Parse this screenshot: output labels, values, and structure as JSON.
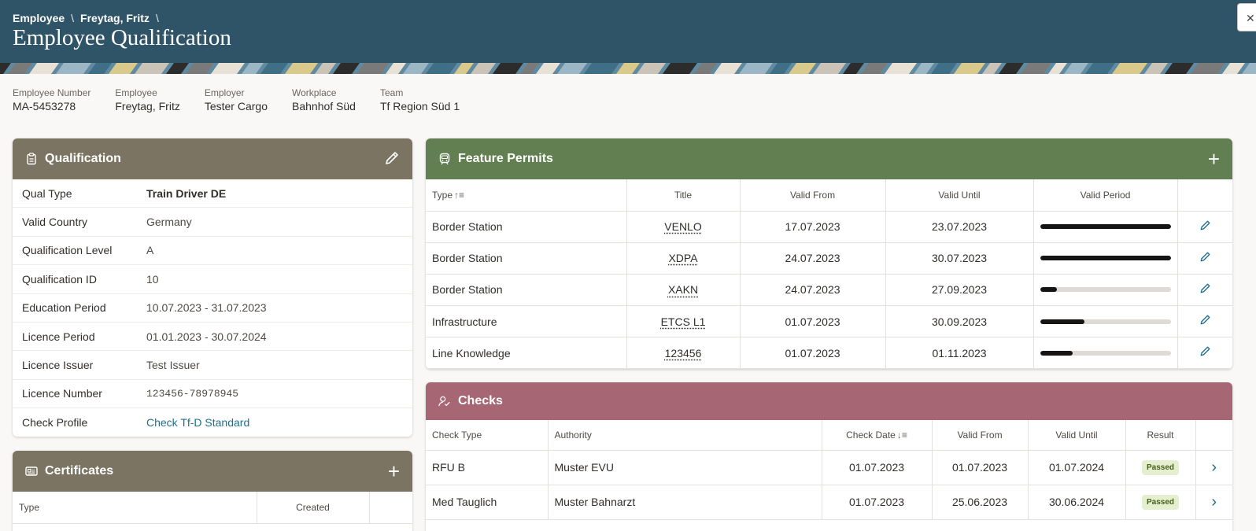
{
  "breadcrumb": {
    "items": [
      "Employee",
      "Freytag, Fritz"
    ],
    "sep": "\\"
  },
  "page_title": "Employee Qualification",
  "close_icon": "close-icon",
  "info": [
    {
      "label": "Employee Number",
      "value": "MA-5453278"
    },
    {
      "label": "Employee",
      "value": "Freytag, Fritz"
    },
    {
      "label": "Employer",
      "value": "Tester Cargo"
    },
    {
      "label": "Workplace",
      "value": "Bahnhof Süd"
    },
    {
      "label": "Team",
      "value": "Tf Region Süd 1"
    }
  ],
  "qualification": {
    "title": "Qualification",
    "icon": "clipboard-icon",
    "edit_icon": "pencil-icon",
    "color": "#7b7462",
    "rows": [
      {
        "k": "Qual Type",
        "v": "Train Driver DE"
      },
      {
        "k": "Valid Country",
        "v": "Germany"
      },
      {
        "k": "Qualification Level",
        "v": "A"
      },
      {
        "k": "Qualification ID",
        "v": "10"
      },
      {
        "k": "Education Period",
        "v": "10.07.2023 - 31.07.2023"
      },
      {
        "k": "Licence Period",
        "v": "01.01.2023 - 30.07.2024"
      },
      {
        "k": "Licence Issuer",
        "v": "Test Issuer"
      },
      {
        "k": "Licence Number",
        "v": "123456-78978945"
      },
      {
        "k": "Check Profile",
        "v": "Check Tf-D Standard"
      }
    ]
  },
  "certificates": {
    "title": "Certificates",
    "icon": "id-card-icon",
    "add_label": "+",
    "columns": [
      "Type",
      "Created",
      ""
    ]
  },
  "feature_permits": {
    "title": "Feature Permits",
    "icon": "train-icon",
    "add_label": "+",
    "color": "#617f50",
    "columns": [
      "Type",
      "Title",
      "Valid From",
      "Valid Until",
      "Valid Period",
      ""
    ],
    "sort_glyph": "↑≡",
    "rows": [
      {
        "type": "Border Station",
        "title": "VENLO",
        "from": "17.07.2023",
        "until": "23.07.2023",
        "period": 1.0
      },
      {
        "type": "Border Station",
        "title": "XDPA",
        "from": "24.07.2023",
        "until": "30.07.2023",
        "period": 1.0
      },
      {
        "type": "Border Station",
        "title": "XAKN",
        "from": "24.07.2023",
        "until": "27.09.2023",
        "period": 0.13
      },
      {
        "type": "Infrastructure",
        "title": "ETCS L1",
        "from": "01.07.2023",
        "until": "30.09.2023",
        "period": 0.34
      },
      {
        "type": "Line Knowledge",
        "title": "123456",
        "from": "01.07.2023",
        "until": "01.11.2023",
        "period": 0.25
      }
    ]
  },
  "checks": {
    "title": "Checks",
    "icon": "user-check-icon",
    "color": "#a66673",
    "columns": [
      "Check Type",
      "Authority",
      "Check Date",
      "Valid From",
      "Valid Until",
      "Result",
      ""
    ],
    "sort_glyph": "↓≡",
    "rows": [
      {
        "type": "RFU B",
        "authority": "Muster EVU",
        "date": "01.07.2023",
        "from": "01.07.2023",
        "until": "01.07.2024",
        "result": "Passed"
      },
      {
        "type": "Med Tauglich",
        "authority": "Muster Bahnarzt",
        "date": "01.07.2023",
        "from": "25.06.2023",
        "until": "30.06.2024",
        "result": "Passed"
      }
    ]
  }
}
